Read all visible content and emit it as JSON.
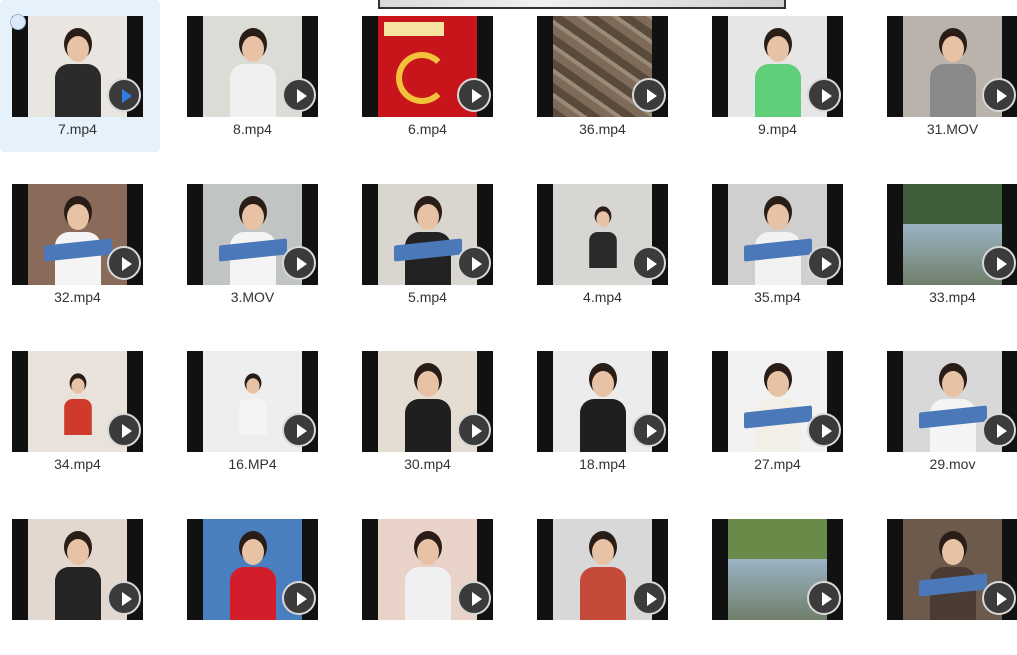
{
  "files": [
    {
      "name": "7.mp4",
      "selected": true,
      "scene": {
        "bg": "#e9e6e2",
        "body": "#2b2b2b",
        "book": false
      }
    },
    {
      "name": "8.mp4",
      "scene": {
        "bg": "#dcdcd6",
        "body": "#f0f0f0",
        "book": false
      }
    },
    {
      "name": "6.mp4",
      "scene": {
        "bg": "#c8141b",
        "body": "#e8b23a",
        "book": false,
        "banner": true
      }
    },
    {
      "name": "36.mp4",
      "scene": {
        "bg": "#6b5c4c",
        "body": "#8a7764",
        "book": false,
        "rubble": true
      }
    },
    {
      "name": "9.mp4",
      "scene": {
        "bg": "#e6e6e6",
        "body": "#5fcf7a",
        "book": false
      }
    },
    {
      "name": "31.MOV",
      "scene": {
        "bg": "#b9b3ac",
        "body": "#8a8a8a",
        "book": false
      }
    },
    {
      "name": "32.mp4",
      "scene": {
        "bg": "#8a6a5a",
        "body": "#f4f4f4",
        "book": true
      }
    },
    {
      "name": "3.MOV",
      "scene": {
        "bg": "#c0c4c2",
        "body": "#f4f4f4",
        "book": true
      }
    },
    {
      "name": "5.mp4",
      "scene": {
        "bg": "#d9d6d0",
        "body": "#222222",
        "book": true
      }
    },
    {
      "name": "4.mp4",
      "scene": {
        "bg": "#d8d6d2",
        "body": "#2a2a2a",
        "book": false,
        "small": true
      }
    },
    {
      "name": "35.mp4",
      "scene": {
        "bg": "#cfcfcf",
        "body": "#f2f2f2",
        "book": true
      }
    },
    {
      "name": "33.mp4",
      "scene": {
        "bg": "#3f5d3a",
        "body": "#7b6a5a",
        "book": false,
        "landscape": true
      }
    },
    {
      "name": "34.mp4",
      "scene": {
        "bg": "#e9e2da",
        "body": "#cf3a2a",
        "book": false,
        "small": true
      }
    },
    {
      "name": "16.MP4",
      "scene": {
        "bg": "#eeeeee",
        "body": "#f4f4f4",
        "book": false,
        "small": true
      }
    },
    {
      "name": "30.mp4",
      "scene": {
        "bg": "#e6ddd2",
        "body": "#1f1f1f",
        "book": false
      }
    },
    {
      "name": "18.mp4",
      "scene": {
        "bg": "#ececec",
        "body": "#1f1f1f",
        "book": false
      }
    },
    {
      "name": "27.mp4",
      "scene": {
        "bg": "#f2f2f2",
        "body": "#f2efe7",
        "book": true
      }
    },
    {
      "name": "29.mov",
      "scene": {
        "bg": "#d8d8d8",
        "body": "#f4f4f4",
        "book": true
      }
    },
    {
      "name": "",
      "scene": {
        "bg": "#e3d8cf",
        "body": "#242424",
        "book": false
      }
    },
    {
      "name": "",
      "scene": {
        "bg": "#4a7fbf",
        "body": "#d41d2a",
        "book": false
      }
    },
    {
      "name": "",
      "scene": {
        "bg": "#e9d3c9",
        "body": "#f0f0f0",
        "book": false
      }
    },
    {
      "name": "",
      "scene": {
        "bg": "#d8d8d8",
        "body": "#c44a3a",
        "book": false
      }
    },
    {
      "name": "",
      "scene": {
        "bg": "#6a8a4a",
        "body": "#f2f2f2",
        "book": false,
        "landscape": true
      }
    },
    {
      "name": "",
      "scene": {
        "bg": "#6c5a4d",
        "body": "#4a3b33",
        "book": true
      }
    }
  ]
}
